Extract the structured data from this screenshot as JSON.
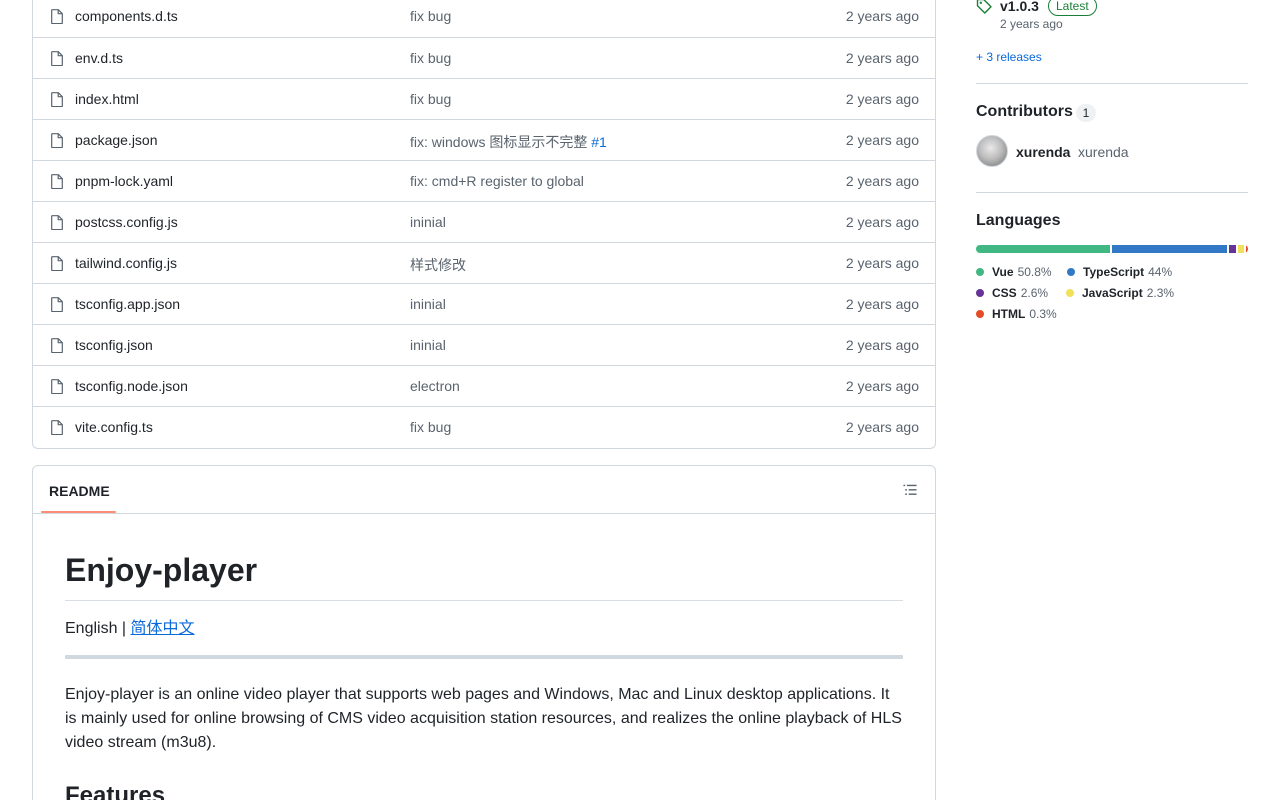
{
  "files": [
    {
      "name": "components.d.ts",
      "message": "fix bug",
      "link": "",
      "time": "2 years ago"
    },
    {
      "name": "env.d.ts",
      "message": "fix bug",
      "link": "",
      "time": "2 years ago"
    },
    {
      "name": "index.html",
      "message": "fix bug",
      "link": "",
      "time": "2 years ago"
    },
    {
      "name": "package.json",
      "message": "fix: windows 图标显示不完整",
      "link": "#1",
      "time": "2 years ago"
    },
    {
      "name": "pnpm-lock.yaml",
      "message": "fix: cmd+R register to global",
      "link": "",
      "time": "2 years ago"
    },
    {
      "name": "postcss.config.js",
      "message": "ininial",
      "link": "",
      "time": "2 years ago"
    },
    {
      "name": "tailwind.config.js",
      "message": "样式修改",
      "link": "",
      "time": "2 years ago"
    },
    {
      "name": "tsconfig.app.json",
      "message": "ininial",
      "link": "",
      "time": "2 years ago"
    },
    {
      "name": "tsconfig.json",
      "message": "ininial",
      "link": "",
      "time": "2 years ago"
    },
    {
      "name": "tsconfig.node.json",
      "message": "electron",
      "link": "",
      "time": "2 years ago"
    },
    {
      "name": "vite.config.ts",
      "message": "fix bug",
      "link": "",
      "time": "2 years ago"
    }
  ],
  "readme": {
    "tab_label": "README",
    "title": "Enjoy-player",
    "lang_prefix": "English | ",
    "lang_link": "简体中文",
    "description": "Enjoy-player is an online video player that supports web pages and Windows, Mac and Linux desktop applications. It is mainly used for online browsing of CMS video acquisition station resources, and realizes the online playback of HLS video stream (m3u8).",
    "next_heading": "Features"
  },
  "sidebar": {
    "release": {
      "version": "v1.0.3",
      "badge": "Latest",
      "time": "2 years ago",
      "more": "+ 3 releases"
    },
    "contributors": {
      "title": "Contributors",
      "count": "1",
      "login": "xurenda",
      "name": "xurenda"
    },
    "languages": {
      "title": "Languages",
      "items": [
        {
          "name": "Vue",
          "pct": "50.8%",
          "value": 50.8,
          "color": "#41b883"
        },
        {
          "name": "TypeScript",
          "pct": "44%",
          "value": 44,
          "color": "#3178c6"
        },
        {
          "name": "CSS",
          "pct": "2.6%",
          "value": 2.6,
          "color": "#663399"
        },
        {
          "name": "JavaScript",
          "pct": "2.3%",
          "value": 2.3,
          "color": "#f1e05a"
        },
        {
          "name": "HTML",
          "pct": "0.3%",
          "value": 0.3,
          "color": "#e34c26"
        }
      ]
    }
  }
}
